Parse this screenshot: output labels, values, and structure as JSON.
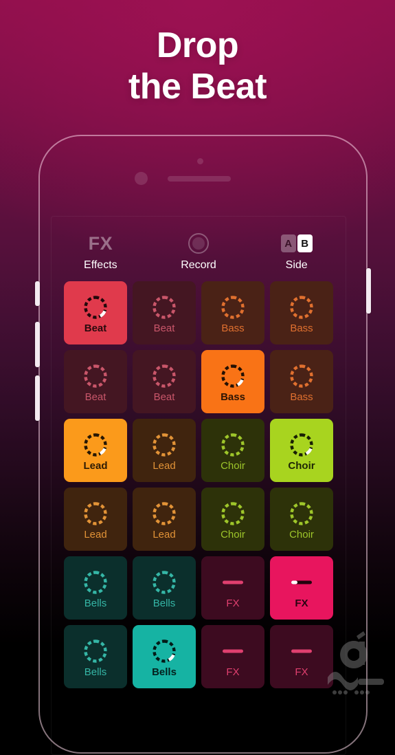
{
  "headline": {
    "line1": "Drop",
    "line2": "the Beat"
  },
  "phone": {
    "buttons": [
      "mute-switch",
      "volume-up",
      "volume-down",
      "power"
    ],
    "sensor": "proximity-sensor",
    "camera": "front-camera",
    "speaker": "earpiece-speaker"
  },
  "toolbar": [
    {
      "glyph": "FX",
      "icon": "fx-icon",
      "label": "Effects"
    },
    {
      "glyph": "",
      "icon": "record-icon",
      "label": "Record"
    },
    {
      "glyph": "",
      "icon": "side-ab-icon",
      "label": "Side",
      "chip_a": "A",
      "chip_b": "B",
      "selected": "B"
    }
  ],
  "colors": {
    "beat": "#e03a4c",
    "bass": "#f97316",
    "lead": "#fb9a1b",
    "choir": "#a8d41f",
    "bells": "#16b3a3",
    "fx": "#e8155e",
    "background_top": "#8d0f4a",
    "background_bottom": "#000000"
  },
  "grid": {
    "columns": 4,
    "pads": [
      {
        "label": "Beat",
        "family": "beat",
        "icon": "loop-ring-icon",
        "active": true
      },
      {
        "label": "Beat",
        "family": "beat",
        "icon": "loop-ring-icon",
        "active": false
      },
      {
        "label": "Bass",
        "family": "bass",
        "icon": "loop-ring-icon",
        "active": false
      },
      {
        "label": "Bass",
        "family": "bass",
        "icon": "loop-ring-icon",
        "active": false
      },
      {
        "label": "Beat",
        "family": "beat",
        "icon": "loop-ring-icon",
        "active": false
      },
      {
        "label": "Beat",
        "family": "beat",
        "icon": "loop-ring-icon",
        "active": false
      },
      {
        "label": "Bass",
        "family": "bass",
        "icon": "loop-ring-icon",
        "active": true
      },
      {
        "label": "Bass",
        "family": "bass",
        "icon": "loop-ring-icon",
        "active": false
      },
      {
        "label": "Lead",
        "family": "lead",
        "icon": "loop-ring-icon",
        "active": true
      },
      {
        "label": "Lead",
        "family": "lead",
        "icon": "loop-ring-icon",
        "active": false
      },
      {
        "label": "Choir",
        "family": "choir",
        "icon": "loop-ring-icon",
        "active": false
      },
      {
        "label": "Choir",
        "family": "choir",
        "icon": "loop-ring-icon",
        "active": true
      },
      {
        "label": "Lead",
        "family": "lead",
        "icon": "loop-ring-icon",
        "active": false
      },
      {
        "label": "Lead",
        "family": "lead",
        "icon": "loop-ring-icon",
        "active": false
      },
      {
        "label": "Choir",
        "family": "choir",
        "icon": "loop-ring-icon",
        "active": false
      },
      {
        "label": "Choir",
        "family": "choir",
        "icon": "loop-ring-icon",
        "active": false
      },
      {
        "label": "Bells",
        "family": "bells",
        "icon": "loop-ring-icon",
        "active": false
      },
      {
        "label": "Bells",
        "family": "bells",
        "icon": "loop-ring-icon",
        "active": false
      },
      {
        "label": "FX",
        "family": "fx",
        "icon": "fx-bar-icon",
        "active": false
      },
      {
        "label": "FX",
        "family": "fx",
        "icon": "fx-bar-icon",
        "active": true
      },
      {
        "label": "Bells",
        "family": "bells",
        "icon": "loop-ring-icon",
        "active": false
      },
      {
        "label": "Bells",
        "family": "bells",
        "icon": "loop-ring-icon",
        "active": true
      },
      {
        "label": "FX",
        "family": "fx",
        "icon": "fx-bar-icon",
        "active": false
      },
      {
        "label": "FX",
        "family": "fx",
        "icon": "fx-bar-icon",
        "active": false
      }
    ]
  },
  "watermark": {
    "icon": "site-watermark-logo"
  }
}
